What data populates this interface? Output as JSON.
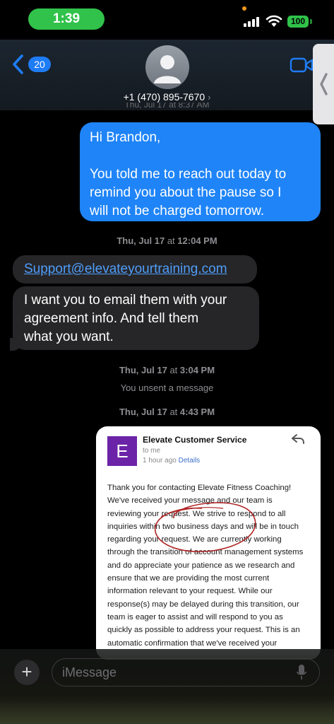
{
  "status_bar": {
    "time": "1:39",
    "battery": "100",
    "accent_green": "#30c24a"
  },
  "header": {
    "back_badge_count": "20",
    "contact_name": "+1 (470) 895-7670",
    "contact_chevron": "›",
    "avatar_icon": "person-silhouette-icon",
    "video_icon": "video-camera-icon",
    "accent_blue": "#1e7cf5"
  },
  "messages": {
    "cut_timestamp": "Thu, Jul 17 at 8:37 AM",
    "outgoing_1": {
      "lines": [
        "Hi Brandon,",
        "",
        "You told me to reach out today to",
        "remind you about the pause so I",
        "will not be charged tomorrow."
      ]
    },
    "timestamp_2": {
      "day": "Thu, Jul 17",
      "time": "12:04 PM"
    },
    "incoming_link": "Support@elevateyourtraining.com",
    "incoming_2": {
      "lines": [
        "I want you to email them with your",
        "agreement info. And tell them",
        "what you want."
      ]
    },
    "timestamp_3": {
      "day": "Thu, Jul 17",
      "time": "3:04 PM"
    },
    "unsent_note": "You unsent a message",
    "timestamp_4": {
      "day": "Thu, Jul 17",
      "time": "4:43 PM"
    }
  },
  "email_image": {
    "avatar_letter": "E",
    "sender": "Elevate Customer Service",
    "to": "to me",
    "time": "1 hour ago",
    "details_link": "Details",
    "body_lines": [
      "Thank you for contacting Elevate Fitness Coaching!",
      "We've received your message and our team is",
      "reviewing your request. We strive to respond to all",
      "inquiries within two business days and will be in touch",
      "regarding your request. We are currently working",
      "through the transition of account management systems",
      "and do appreciate your patience as we research and",
      "ensure that we are providing the most current",
      "information relevant to your request. While our",
      "response(s) may be delayed during this transition, our",
      "team is eager to assist and will respond to you as",
      "quickly as possible to address your request. This is an",
      "automatic confirmation that we've received your"
    ],
    "avatar_color": "#6b23a8"
  },
  "compose": {
    "plus_label": "+",
    "placeholder": "iMessage",
    "mic_icon": "microphone-icon"
  }
}
